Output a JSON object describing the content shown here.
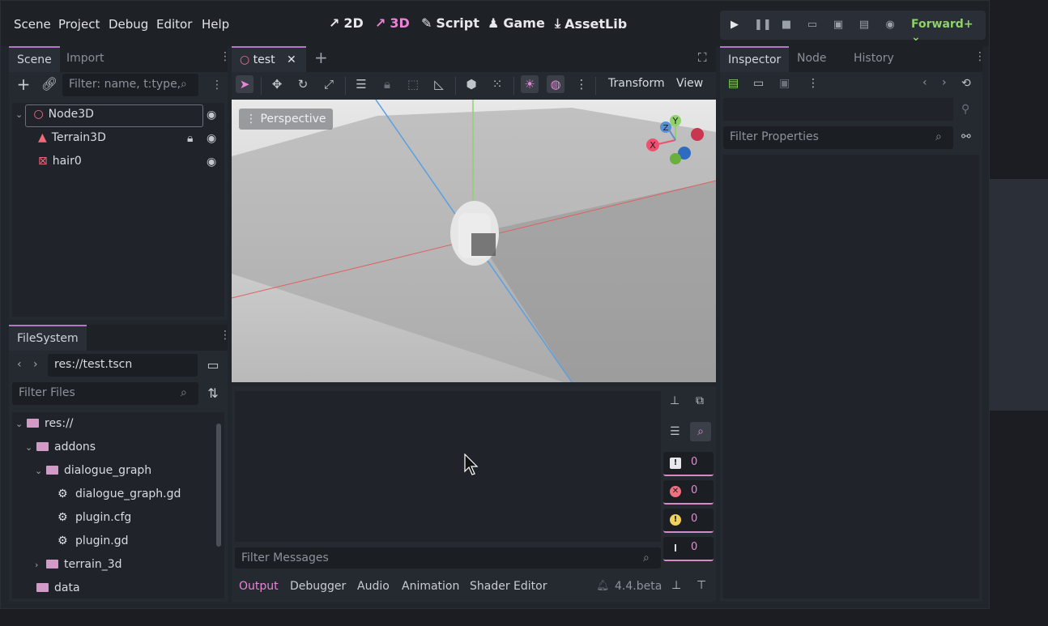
{
  "menu": [
    "Scene",
    "Project",
    "Debug",
    "Editor",
    "Help"
  ],
  "workspaces": [
    {
      "label": "2D",
      "icon": "2d-icon",
      "active": false
    },
    {
      "label": "3D",
      "icon": "3d-icon",
      "active": true
    },
    {
      "label": "Script",
      "icon": "script-icon",
      "active": false
    },
    {
      "label": "Game",
      "icon": "game-icon",
      "active": false
    },
    {
      "label": "AssetLib",
      "icon": "assetlib-icon",
      "active": false
    }
  ],
  "renderer": "Forward+",
  "scene_dock": {
    "tabs": [
      "Scene",
      "Import"
    ],
    "filter_placeholder": "Filter: name, t:type,",
    "tree": [
      {
        "label": "Node3D",
        "icon": "node3d-icon"
      },
      {
        "label": "Terrain3D",
        "icon": "terrain3d-icon"
      },
      {
        "label": "hair0",
        "icon": "meshinstance-icon"
      }
    ]
  },
  "filesystem": {
    "tab": "FileSystem",
    "path": "res://test.tscn",
    "filter_placeholder": "Filter Files",
    "tree": [
      {
        "label": "res://",
        "type": "folder"
      },
      {
        "label": "addons",
        "type": "folder"
      },
      {
        "label": "dialogue_graph",
        "type": "folder"
      },
      {
        "label": "dialogue_graph.gd",
        "type": "script"
      },
      {
        "label": "plugin.cfg",
        "type": "config"
      },
      {
        "label": "plugin.gd",
        "type": "script"
      },
      {
        "label": "terrain_3d",
        "type": "folder"
      },
      {
        "label": "data",
        "type": "folder"
      }
    ]
  },
  "editor_tab": "test",
  "viewport": {
    "toolbar_menus": [
      "Transform",
      "View"
    ],
    "perspective_label": "Perspective",
    "gizmo_axes": [
      "X",
      "Y",
      "Z"
    ]
  },
  "output": {
    "filter_placeholder": "Filter Messages",
    "counts": [
      0,
      0,
      0,
      0
    ],
    "bottom_tabs": [
      "Output",
      "Debugger",
      "Audio",
      "Animation",
      "Shader Editor"
    ],
    "version": "4.4.beta"
  },
  "inspector": {
    "tabs": [
      "Inspector",
      "Node",
      "History"
    ],
    "filter_placeholder": "Filter Properties"
  },
  "colors": {
    "accent": "#e985d6",
    "panel": "#252a31",
    "background": "#21252c"
  }
}
